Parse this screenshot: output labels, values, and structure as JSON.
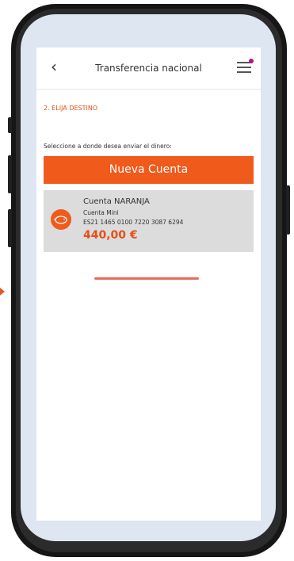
{
  "header": {
    "back_icon": "chevron-left-icon",
    "title": "Transferencia nacional",
    "menu_icon": "hamburger-menu-icon",
    "notification_color": "#b5147a"
  },
  "content": {
    "step_label": "2. ELIJA DESTINO",
    "prompt": "Seleccione a donde desea enviar el dinero:",
    "new_account_button": "Nueva Cuenta"
  },
  "account": {
    "icon": "piggy-bank-icon",
    "name": "Cuenta NARANJA",
    "type": "Cuenta Mini",
    "iban": "ES21 1465 0100 7220 3087 6294",
    "balance": "440,00 €"
  },
  "loading": {
    "progress": 1.0
  },
  "colors": {
    "accent": "#f05a1b",
    "card_bg": "#dcdcdc",
    "progress": "#ed6a5a"
  }
}
